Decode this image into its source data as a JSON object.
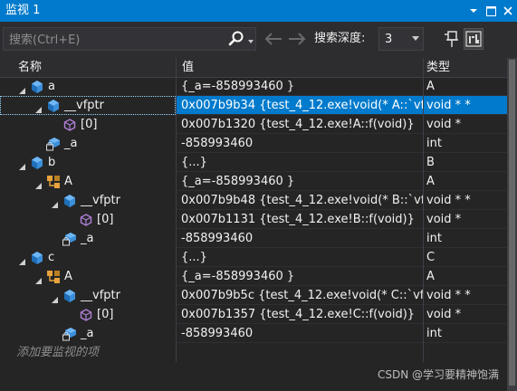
{
  "window": {
    "title": "监视 1"
  },
  "search": {
    "placeholder": "搜索(Ctrl+E)",
    "depth_label": "搜索深度:",
    "depth_value": "3"
  },
  "columns": {
    "name": "名称",
    "value": "值",
    "type": "类型"
  },
  "rows": [
    {
      "name": "a",
      "value": "{_a=-858993460 }",
      "type": "A",
      "icon": "object-icon",
      "expander": "expanded",
      "level": 0
    },
    {
      "name": "__vfptr",
      "value": "0x007b9b34 {test_4_12.exe!void(* A::`vf...",
      "type": "void * *",
      "icon": "object-icon",
      "expander": "expanded",
      "level": 1,
      "selected": true
    },
    {
      "name": "[0]",
      "value": "0x007b1320 {test_4_12.exe!A::f(void)}",
      "type": "void *",
      "icon": "method-icon",
      "expander": "none",
      "level": 2
    },
    {
      "name": "_a",
      "value": "-858993460",
      "type": "int",
      "icon": "private-field-icon",
      "expander": "none",
      "level": 1
    },
    {
      "name": "b",
      "value": "{...}",
      "type": "B",
      "icon": "object-icon",
      "expander": "expanded",
      "level": 0
    },
    {
      "name": "A",
      "value": "{_a=-858993460 }",
      "type": "A",
      "icon": "base-class-icon",
      "expander": "expanded",
      "level": 1
    },
    {
      "name": "__vfptr",
      "value": "0x007b9b48 {test_4_12.exe!void(* B::`vf...",
      "type": "void * *",
      "icon": "object-icon",
      "expander": "expanded",
      "level": 2
    },
    {
      "name": "[0]",
      "value": "0x007b1131 {test_4_12.exe!B::f(void)}",
      "type": "void *",
      "icon": "method-icon",
      "expander": "none",
      "level": 3
    },
    {
      "name": "_a",
      "value": "-858993460",
      "type": "int",
      "icon": "private-field-icon",
      "expander": "none",
      "level": 2
    },
    {
      "name": "c",
      "value": "{...}",
      "type": "C",
      "icon": "object-icon",
      "expander": "expanded",
      "level": 0
    },
    {
      "name": "A",
      "value": "{_a=-858993460 }",
      "type": "A",
      "icon": "base-class-icon",
      "expander": "expanded",
      "level": 1
    },
    {
      "name": "__vfptr",
      "value": "0x007b9b5c {test_4_12.exe!void(* C::`vf...",
      "type": "void * *",
      "icon": "object-icon",
      "expander": "expanded",
      "level": 2
    },
    {
      "name": "[0]",
      "value": "0x007b1357 {test_4_12.exe!C::f(void)}",
      "type": "void *",
      "icon": "method-icon",
      "expander": "none",
      "level": 3
    },
    {
      "name": "_a",
      "value": "-858993460",
      "type": "int",
      "icon": "private-field-icon",
      "expander": "none",
      "level": 2
    }
  ],
  "add_item": {
    "placeholder": "添加要监视的项"
  },
  "watermark": "CSDN @学习要精神饱满",
  "colors": {
    "accent": "#007acc",
    "background": "#252526",
    "object_icon": "#4aa3f0",
    "method_icon": "#b180d7",
    "base_class_icon": "#e8a33c"
  }
}
